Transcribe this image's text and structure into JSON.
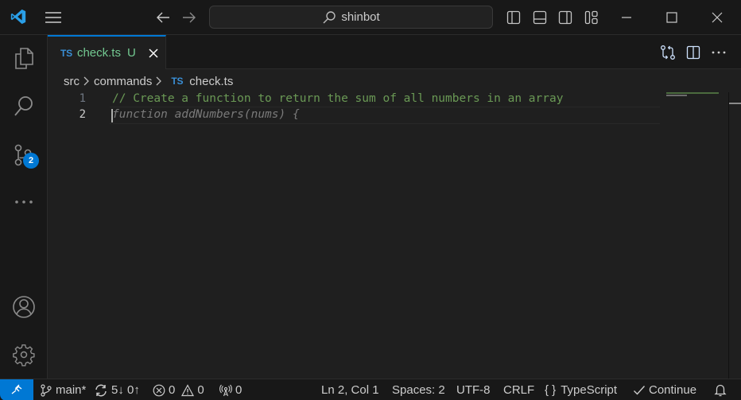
{
  "titlebar": {
    "search_text": "shinbot",
    "icons": {
      "logo": "vscode-logo-icon",
      "menu": "hamburger-menu-icon",
      "back": "arrow-left-icon",
      "forward": "arrow-right-icon",
      "search": "search-icon",
      "layout": [
        "toggle-primary-sidebar-icon",
        "toggle-panel-icon",
        "toggle-secondary-sidebar-icon",
        "customize-layout-icon"
      ],
      "window": [
        "minimize-icon",
        "maximize-icon",
        "close-icon"
      ]
    }
  },
  "activitybar": {
    "items": [
      {
        "name": "explorer",
        "icon": "files-icon"
      },
      {
        "name": "search",
        "icon": "search-icon"
      },
      {
        "name": "source-control",
        "icon": "source-control-icon",
        "badge": "2"
      },
      {
        "name": "more",
        "icon": "ellipsis-icon"
      }
    ],
    "bottom": [
      {
        "name": "accounts",
        "icon": "account-icon"
      },
      {
        "name": "manage",
        "icon": "gear-icon"
      }
    ]
  },
  "tabs": [
    {
      "lang_badge": "TS",
      "label": "check.ts",
      "status": "U",
      "active": true
    }
  ],
  "editor_actions": [
    "open-changes-icon",
    "split-editor-icon",
    "more-actions-icon"
  ],
  "breadcrumb": {
    "items": [
      "src",
      "commands",
      "check.ts"
    ],
    "file_badge": "TS"
  },
  "editor": {
    "lines": [
      {
        "number": "1",
        "text": "// Create a function to return the sum of all numbers in an array",
        "kind": "comment"
      },
      {
        "number": "2",
        "text": "function addNumbers(nums) {",
        "kind": "ghost-suggestion"
      }
    ]
  },
  "statusbar": {
    "branch": "main*",
    "sync": "5↓ 0↑",
    "errors": "0",
    "warnings": "0",
    "ports": "0",
    "position": "Ln 2, Col 1",
    "indent": "Spaces: 2",
    "encoding": "UTF-8",
    "eol": "CRLF",
    "language_icon": "{ }",
    "language": "TypeScript",
    "continue_label": "Continue"
  },
  "colors": {
    "accent": "#0078d4",
    "comment": "#6a9955",
    "untracked": "#73c991",
    "ts_badge": "#3a8fd6"
  }
}
